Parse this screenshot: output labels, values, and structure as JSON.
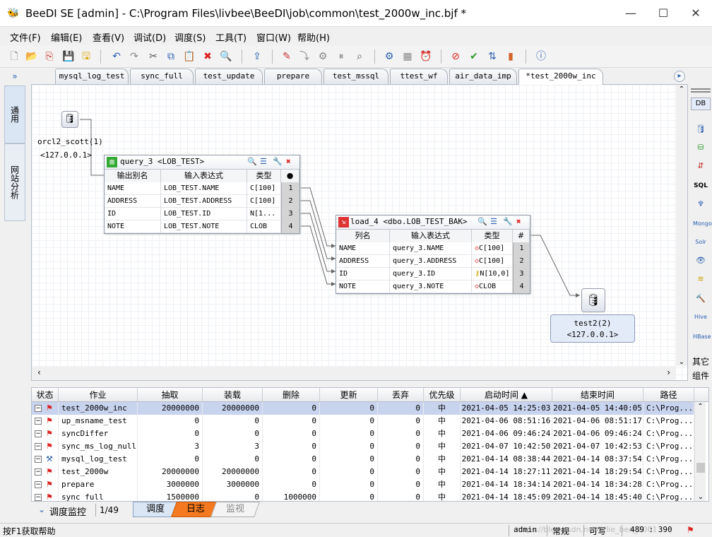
{
  "window": {
    "title": "BeeDI SE [admin] - C:\\Program Files\\livbee\\BeeDI\\job\\common\\test_2000w_inc.bjf *",
    "minimize": "—",
    "maximize": "☐",
    "close": "✕"
  },
  "menu": [
    "文件(F)",
    "编辑(E)",
    "查看(V)",
    "调试(D)",
    "调度(S)",
    "工具(T)",
    "窗口(W)",
    "帮助(H)"
  ],
  "toolbar_icons": [
    "new-icon",
    "open-icon",
    "import-icon",
    "save-icon",
    "save-as-icon",
    "undo-icon",
    "redo-icon",
    "cut-icon",
    "copy-icon",
    "paste-icon",
    "delete-icon",
    "find-icon",
    "publish-icon",
    "edit-job-icon",
    "run-step-icon",
    "debug-icon",
    "pause-icon",
    "find-binoculars-icon",
    "settings-icon",
    "monitor-icon",
    "schedule-icon",
    "stop-icon",
    "check-icon",
    "sort-icon",
    "chart-icon",
    "help-icon"
  ],
  "left_tabs": {
    "expand": "»",
    "tab1": "通用",
    "tab2": "网站分析"
  },
  "file_tabs": [
    "mysql_log_test",
    "sync_full",
    "test_update",
    "prepare",
    "test_mssql",
    "ttest_wf",
    "air_data_imp",
    "*test_2000w_inc"
  ],
  "tab_scroll": "▸",
  "source": {
    "name": "orcl2_scott(1)",
    "host": "<127.0.0.1>"
  },
  "query": {
    "title": "query_3 <LOB_TEST>",
    "headers": [
      "输出别名",
      "输入表达式",
      "类型"
    ],
    "rows": [
      {
        "alias": "NAME",
        "expr": "LOB_TEST.NAME",
        "type": "C[100]",
        "num": "1"
      },
      {
        "alias": "ADDRESS",
        "expr": "LOB_TEST.ADDRESS",
        "type": "C[100]",
        "num": "2"
      },
      {
        "alias": "ID",
        "expr": "LOB_TEST.ID",
        "type": "N[1...",
        "num": "3"
      },
      {
        "alias": "NOTE",
        "expr": "LOB_TEST.NOTE",
        "type": "CLOB",
        "num": "4"
      }
    ]
  },
  "load": {
    "title": "load_4 <dbo.LOB_TEST_BAK>",
    "headers": [
      "列名",
      "输入表达式",
      "类型",
      "#"
    ],
    "rows": [
      {
        "col": "NAME",
        "expr": "query_3.NAME",
        "type": "C[100]",
        "num": "1"
      },
      {
        "col": "ADDRESS",
        "expr": "query_3.ADDRESS",
        "type": "C[100]",
        "num": "2"
      },
      {
        "col": "ID",
        "expr": "query_3.ID",
        "type": "N[10,0]",
        "num": "3"
      },
      {
        "col": "NOTE",
        "expr": "query_3.NOTE",
        "type": "CLOB",
        "num": "4"
      }
    ]
  },
  "target": {
    "name": "test2(2)",
    "host": "<127.0.0.1>"
  },
  "right_palette": {
    "header": "DB",
    "labels": [
      "SQL",
      "Mongo",
      "Solr",
      "Hive",
      "HBase"
    ],
    "footer1": "其它",
    "footer2": "组件"
  },
  "table": {
    "headers": [
      "状态",
      "作业",
      "抽取",
      "装载",
      "删除",
      "更新",
      "丢弃",
      "优先级",
      "启动时间 ▲",
      "结束时间",
      "路径"
    ],
    "rows": [
      {
        "job": "test_2000w_inc",
        "extract": "20000000",
        "load": "20000000",
        "del": "0",
        "upd": "0",
        "drop": "0",
        "pri": "中",
        "start": "2021-04-05 14:25:03",
        "end": "2021-04-05 14:40:05",
        "path": "C:\\Prog..."
      },
      {
        "job": "up_msname_test",
        "extract": "0",
        "load": "0",
        "del": "0",
        "upd": "0",
        "drop": "0",
        "pri": "中",
        "start": "2021-04-06 08:51:16",
        "end": "2021-04-06 08:51:17",
        "path": "C:\\Prog..."
      },
      {
        "job": "syncDiffer",
        "extract": "0",
        "load": "0",
        "del": "0",
        "upd": "0",
        "drop": "0",
        "pri": "中",
        "start": "2021-04-06 09:46:24",
        "end": "2021-04-06 09:46:24",
        "path": "C:\\Prog..."
      },
      {
        "job": "sync_ms_log_null",
        "extract": "3",
        "load": "3",
        "del": "0",
        "upd": "0",
        "drop": "0",
        "pri": "中",
        "start": "2021-04-07 10:42:50",
        "end": "2021-04-07 10:42:53",
        "path": "C:\\Prog..."
      },
      {
        "job": "mysql_log_test",
        "extract": "0",
        "load": "0",
        "del": "0",
        "upd": "0",
        "drop": "0",
        "pri": "中",
        "start": "2021-04-14 08:38:44",
        "end": "2021-04-14 08:37:54",
        "path": "C:\\Prog..."
      },
      {
        "job": "test_2000w",
        "extract": "20000000",
        "load": "20000000",
        "del": "0",
        "upd": "0",
        "drop": "0",
        "pri": "中",
        "start": "2021-04-14 18:27:11",
        "end": "2021-04-14 18:29:54",
        "path": "C:\\Prog..."
      },
      {
        "job": "prepare",
        "extract": "3000000",
        "load": "3000000",
        "del": "0",
        "upd": "0",
        "drop": "0",
        "pri": "中",
        "start": "2021-04-14 18:34:14",
        "end": "2021-04-14 18:34:28",
        "path": "C:\\Prog..."
      },
      {
        "job": "sync_full",
        "extract": "1500000",
        "load": "0",
        "del": "1000000",
        "upd": "0",
        "drop": "0",
        "pri": "中",
        "start": "2021-04-14 18:45:09",
        "end": "2021-04-14 18:45:40",
        "path": "C:\\Prog..."
      }
    ]
  },
  "bottom": {
    "monitor": "调度监控",
    "page": "1/49",
    "tabs": [
      "调度",
      "日志",
      "监视"
    ]
  },
  "status": {
    "help": "按F1获取帮助",
    "user": "admin",
    "mode": "常规",
    "write": "可写",
    "coords": "489 : 390",
    "watermark": "https://blog.csdn.net/litlie_bee_2001"
  }
}
